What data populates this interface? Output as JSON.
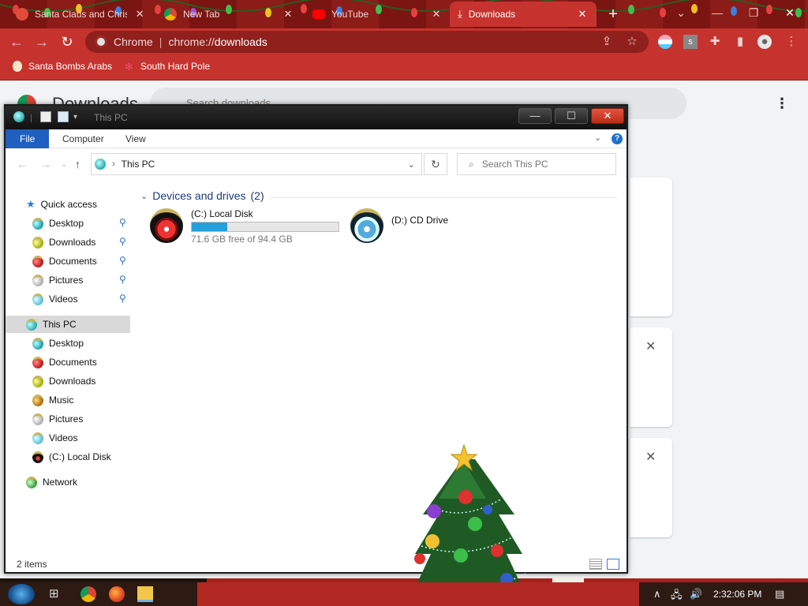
{
  "browser": {
    "tabs": [
      {
        "title": "Santa Claus and Chris"
      },
      {
        "title": "New Tab"
      },
      {
        "title": "YouTube"
      },
      {
        "title": "Downloads"
      }
    ],
    "omnibox": {
      "site_name": "Chrome",
      "url_host": "chrome://",
      "url_path": "downloads"
    },
    "bookmarks": [
      {
        "label": "Santa Bombs Arabs"
      },
      {
        "label": "South Hard Pole"
      }
    ],
    "page": {
      "title": "Downloads",
      "search_placeholder": "Search downloads"
    },
    "theme": {
      "frame": "#7a1512",
      "toolbar": "#c6332e",
      "active_tab": "#c6332e"
    }
  },
  "explorer": {
    "title": "This PC",
    "ribbon_tabs": [
      "File",
      "Computer",
      "View"
    ],
    "address": "This PC",
    "search_placeholder": "Search This PC",
    "quick_access": {
      "label": "Quick access",
      "items": [
        "Desktop",
        "Downloads",
        "Documents",
        "Pictures",
        "Videos"
      ]
    },
    "this_pc": {
      "label": "This PC",
      "items": [
        "Desktop",
        "Documents",
        "Downloads",
        "Music",
        "Pictures",
        "Videos",
        "(C:) Local Disk"
      ]
    },
    "network": "Network",
    "group": {
      "label": "Devices and drives",
      "count": "(2)"
    },
    "drives": [
      {
        "name": "(C:) Local Disk",
        "free_text": "71.6 GB free of 94.4 GB",
        "used_fraction": 0.24
      },
      {
        "name": "(D:) CD Drive"
      }
    ],
    "status": "2 items"
  },
  "taskbar": {
    "clock": "2:32:06 PM"
  }
}
